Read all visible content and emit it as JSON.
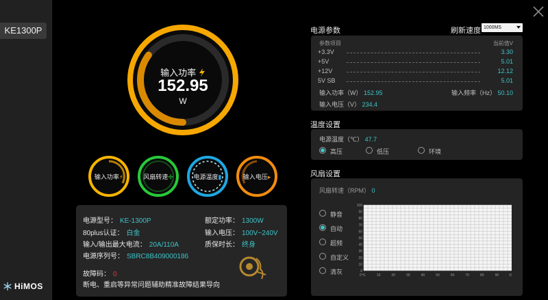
{
  "sidebar": {
    "model_tab": "KE1300P",
    "brand": "HiMOS"
  },
  "main_gauge": {
    "label": "输入功率",
    "value": "152.95",
    "unit": "W",
    "fraction": 0.35
  },
  "small_gauges": [
    {
      "label": "输入功率",
      "color": "#f6b400",
      "icon": "lightning-icon"
    },
    {
      "label": "风扇转速",
      "color": "#28c93a",
      "icon": "fan-icon"
    },
    {
      "label": "电源温度",
      "color": "#1ea7e1",
      "icon": "thermometer-icon"
    },
    {
      "label": "输入电压",
      "color": "#f28c0f",
      "icon": "plug-icon"
    }
  ],
  "info": {
    "model_label": "电源型号：",
    "model_value": "KE-1300P",
    "rated_label": "额定功率：",
    "rated_value": "1300W",
    "cert_label": "80plus认证：",
    "cert_value": "白金",
    "input_v_label": "输入电压：",
    "input_v_value": "100V~240V",
    "max_current_label": "输入/输出最大电流：",
    "max_current_value": "20A/110A",
    "warranty_label": "质保时长：",
    "warranty_value": "终身",
    "serial_label": "电源序列号：",
    "serial_value": "SBRC8B409000186",
    "fault_label": "故障码：",
    "fault_value": "0",
    "fault_note": "断电、重启等异常问题辅助精准故障结果导向"
  },
  "power_params": {
    "title": "电源参数",
    "refresh_label": "刷新速度",
    "refresh_value": "1000MS",
    "col_item": "参数项目",
    "col_current": "当前值V",
    "rows": [
      {
        "name": "+3.3V",
        "value": "3.30"
      },
      {
        "name": "+5V",
        "value": "5.01"
      },
      {
        "name": "+12V",
        "value": "12.12"
      },
      {
        "name": "5V SB",
        "value": "5.01"
      }
    ],
    "input_power_label": "输入功率（W）",
    "input_power_value": "152.95",
    "input_freq_label": "输入频率（Hz）",
    "input_freq_value": "50.10",
    "input_voltage_label": "输入电压（V）",
    "input_voltage_value": "234.4"
  },
  "temp_settings": {
    "title": "温度设置",
    "temp_label": "电源温度（℃）",
    "temp_value": "47.7",
    "options": [
      "高压",
      "低压",
      "环境"
    ],
    "selected": 0
  },
  "fan_settings": {
    "title": "风扇设置",
    "speed_label": "风扇转速（RPM）",
    "speed_value": "0",
    "modes": [
      "静音",
      "自动",
      "超频",
      "自定义",
      "清灰"
    ],
    "selected": 1,
    "chart_y_ticks": [
      "100",
      "90",
      "80",
      "70",
      "60",
      "50",
      "40",
      "30",
      "20",
      "10",
      "0"
    ],
    "chart_x_ticks": [
      "℃",
      "10",
      "20",
      "30",
      "40",
      "50",
      "60",
      "70",
      "80",
      "90",
      "100"
    ]
  },
  "colors": {
    "accent": "#3dc4c9",
    "gauge_orange": "#f6a800",
    "fault": "#e23b3b"
  }
}
